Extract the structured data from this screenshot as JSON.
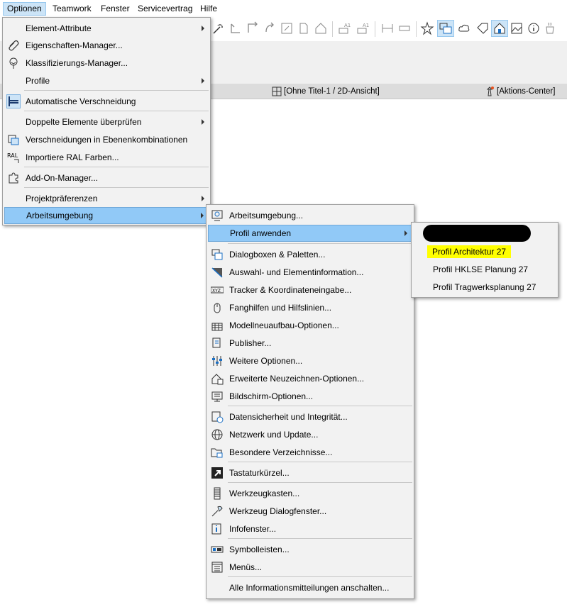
{
  "menubar": {
    "items": [
      "Optionen",
      "Teamwork",
      "Fenster",
      "Servicevertrag",
      "Hilfe"
    ],
    "active": "Optionen"
  },
  "tabs": {
    "doc_tab": "[Ohne Titel-1 / 2D-Ansicht]",
    "action_center": "[Aktions-Center]"
  },
  "optionen_menu": {
    "items": [
      {
        "label": "Element-Attribute",
        "icon": "none",
        "submenu": true
      },
      {
        "label": "Eigenschaften-Manager...",
        "icon": "paperclip-icon"
      },
      {
        "label": "Klassifizierungs-Manager...",
        "icon": "tree-icon"
      },
      {
        "label": "Profile",
        "icon": "none",
        "submenu": true
      },
      {
        "label": "Automatische Verschneidung",
        "icon": "auto-intersection-icon",
        "checked": true
      },
      {
        "label": "Doppelte Elemente überprüfen",
        "icon": "none",
        "submenu": true
      },
      {
        "label": "Verschneidungen in Ebenenkombinationen",
        "icon": "layer-intersection-icon"
      },
      {
        "label": "Importiere RAL Farben...",
        "icon": "ral-icon"
      },
      {
        "label": "Add-On-Manager...",
        "icon": "puzzle-icon"
      },
      {
        "label": "Projektpräferenzen",
        "icon": "none",
        "submenu": true
      },
      {
        "label": "Arbeitsumgebung",
        "icon": "none",
        "submenu": true,
        "highlighted": true
      }
    ]
  },
  "arbeitsumgebung_menu": {
    "items": [
      {
        "label": "Arbeitsumgebung...",
        "icon": "work-environment-icon"
      },
      {
        "label": "Profil anwenden",
        "submenu": true,
        "highlighted": true
      },
      {
        "label": "Dialogboxen & Paletten...",
        "icon": "dialog-palette-icon"
      },
      {
        "label": "Auswahl- und Elementinformation...",
        "icon": "selection-info-icon"
      },
      {
        "label": "Tracker & Koordinateneingabe...",
        "icon": "xyz-icon"
      },
      {
        "label": "Fanghilfen und Hilfslinien...",
        "icon": "mouse-icon"
      },
      {
        "label": "Modellneuaufbau-Optionen...",
        "icon": "rebuild-icon"
      },
      {
        "label": "Publisher...",
        "icon": "publisher-icon"
      },
      {
        "label": "Weitere Optionen...",
        "icon": "sliders-icon"
      },
      {
        "label": "Erweiterte Neuzeichnen-Optionen...",
        "icon": "redraw-icon"
      },
      {
        "label": "Bildschirm-Optionen...",
        "icon": "screen-icon"
      },
      {
        "label": "Datensicherheit und Integrität...",
        "icon": "data-safety-icon"
      },
      {
        "label": "Netzwerk und Update...",
        "icon": "globe-icon"
      },
      {
        "label": "Besondere Verzeichnisse...",
        "icon": "folder-icon"
      },
      {
        "label": "Tastaturkürzel...",
        "icon": "shortcut-icon"
      },
      {
        "label": "Werkzeugkasten...",
        "icon": "toolbox-icon"
      },
      {
        "label": "Werkzeug Dialogfenster...",
        "icon": "tool-dialog-icon"
      },
      {
        "label": "Infofenster...",
        "icon": "info-window-icon"
      },
      {
        "label": "Symbolleisten...",
        "icon": "toolbar-icon"
      },
      {
        "label": "Menüs...",
        "icon": "menus-icon"
      },
      {
        "label": "Alle Informationsmitteilungen anschalten...",
        "icon": "none"
      }
    ]
  },
  "profil_menu": {
    "items": [
      {
        "label": "Profil Architektur 27",
        "highlight_color": "#ffff00"
      },
      {
        "label": "Profil HKLSE Planung 27"
      },
      {
        "label": "Profil Tragwerksplanung 27"
      }
    ]
  },
  "colors": {
    "menu_highlight": "#91c9f7",
    "menubar_active": "#cce4f7",
    "menu_bg": "#f2f2f2",
    "yellow_marker": "#ffff00"
  }
}
